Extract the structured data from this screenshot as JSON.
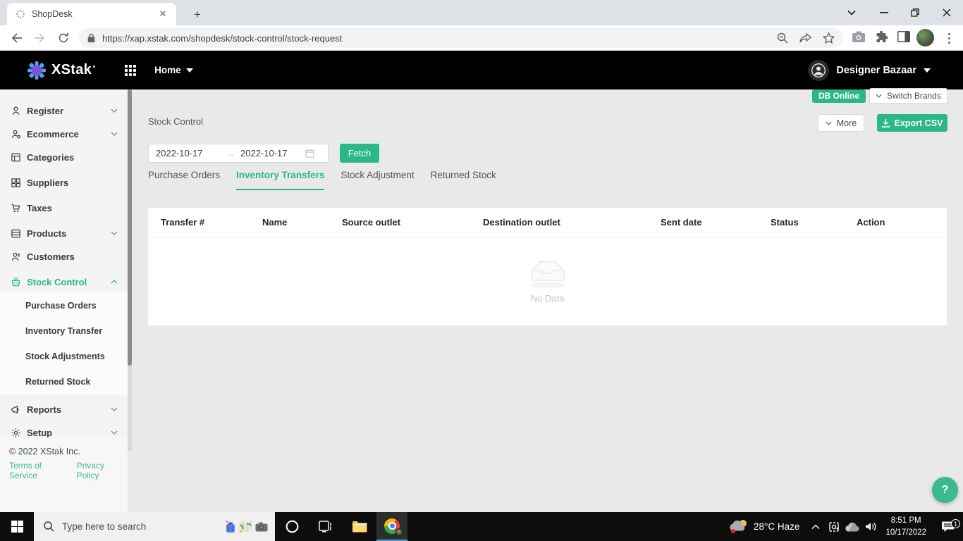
{
  "browser": {
    "tab_title": "ShopDesk",
    "url": "https://xap.xstak.com/shopdesk/stock-control/stock-request"
  },
  "navbar": {
    "brand": "XStak",
    "menu_home": "Home",
    "user": "Designer Bazaar"
  },
  "sidebar": {
    "items": [
      "Register",
      "Ecommerce",
      "Categories",
      "Suppliers",
      "Taxes",
      "Products",
      "Customers",
      "Stock Control",
      "Reports",
      "Setup"
    ],
    "submenu": [
      "Purchase Orders",
      "Inventory Transfer",
      "Stock Adjustments",
      "Returned Stock"
    ],
    "footer": {
      "copyright": "© 2022 XStak Inc.",
      "terms": "Terms of Service",
      "privacy": "Privacy Policy"
    }
  },
  "content": {
    "db_status": "DB Online",
    "switch_brands": "Switch Brands",
    "page_title": "Stock Control",
    "more_label": "More",
    "export_label": "Export CSV",
    "date_from": "2022-10-17",
    "date_to": "2022-10-17",
    "fetch_label": "Fetch",
    "tabs": [
      "Purchase Orders",
      "Inventory Transfers",
      "Stock Adjustment",
      "Returned Stock"
    ],
    "active_tab": "Inventory Transfers",
    "table_headers": [
      "Transfer #",
      "Name",
      "Source outlet",
      "Destination outlet",
      "Sent date",
      "Status",
      "Action"
    ],
    "empty_text": "No Data",
    "help_label": "?"
  },
  "taskbar": {
    "search_placeholder": "Type here to search",
    "weather": "28°C  Haze",
    "time": "8:51 PM",
    "date": "10/17/2022",
    "notification_count": "1"
  },
  "colors": {
    "accent_green": "#2bb886",
    "navbar_black": "#000000",
    "content_bg": "#e9e9e9",
    "chrome_underline": "#4aa3e0"
  }
}
